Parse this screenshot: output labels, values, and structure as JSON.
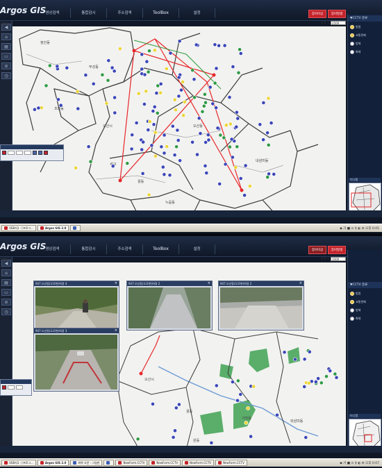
{
  "app": {
    "title": "Argos GIS",
    "menu": [
      "영상검색",
      "통합감시",
      "주소검색",
      "ToolBox",
      "설정"
    ],
    "red_buttons": [
      "장비이상",
      "장비발생"
    ]
  },
  "screen1": {
    "scale_label": "축척 1",
    "scale_value": "2500",
    "left_label": "공통",
    "right_panel": {
      "title": "▼CCTV 종류",
      "items": [
        "방범",
        "교통관제",
        "방재",
        "화재"
      ]
    },
    "minimap_title": "미니맵",
    "taskbar": [
      {
        "label": "USB지1 - [프로그...",
        "active": false,
        "icon": "red"
      },
      {
        "label": "Argos GIS 2.0",
        "active": true,
        "icon": "red"
      },
      {
        "label": "",
        "active": false,
        "icon": "blue"
      }
    ],
    "tray": "◆ 거 ■ ⊙ ♀ ◐ ⚙ 오후 0:05",
    "map_labels": [
      "정안동",
      "부성동",
      "오산시",
      "세교",
      "초평동",
      "내삼미동",
      "궐동",
      "누읍동",
      "오산동"
    ]
  },
  "screen2": {
    "scale_label": "축척 1",
    "scale_value": "1000",
    "left_label": "공통",
    "right_panel": {
      "title": "▼CCTV 종류",
      "items": [
        "방범",
        "교통관제",
        "방재",
        "화재"
      ]
    },
    "minimap_title": "미니맵",
    "cctv_windows": [
      {
        "title": "947.오산동(도로변)여경 4"
      },
      {
        "title": "947.오산동(도로변)여경 2"
      },
      {
        "title": "947.오산동(도로변)여경 2"
      },
      {
        "title": "947.오산동(도로변)여경 3"
      }
    ],
    "map_labels": [
      "오산시",
      "궐동",
      "가장동",
      "원동",
      "외삼미동"
    ],
    "taskbar": [
      {
        "label": "USB지1 - [프로그...",
        "active": false,
        "icon": "red"
      },
      {
        "label": "Argos GIS 2.0",
        "active": true,
        "icon": "red"
      },
      {
        "label": "화북 오픈 - 그림판",
        "active": false,
        "icon": "blue"
      },
      {
        "label": "",
        "active": false,
        "icon": "blue"
      },
      {
        "label": "NewForm.CCTV",
        "active": false,
        "icon": "red"
      },
      {
        "label": "NewForm.CCTV",
        "active": false,
        "icon": "red"
      },
      {
        "label": "NewForm.CCTV",
        "active": false,
        "icon": "red"
      },
      {
        "label": "NewForm.CCTV",
        "active": false,
        "icon": "red"
      }
    ],
    "tray": "◆ 거 ■ ⊙ ♀ ◐ ⚙ 오후 0:07"
  },
  "colors": {
    "accent_red": "#c4232b",
    "frame_dark": "#101827",
    "map_bg": "#f2f2f0",
    "route_red": "#e8262a",
    "park_green": "#5aae6a",
    "river_blue": "#6a9ad4"
  }
}
